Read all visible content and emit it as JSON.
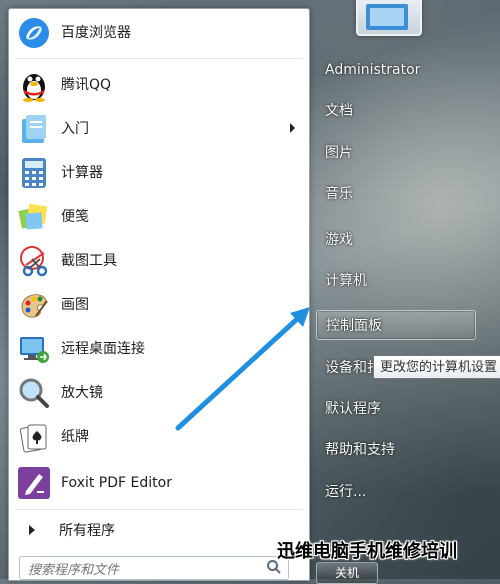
{
  "start_menu": {
    "programs": [
      {
        "label": "百度浏览器",
        "icon": "baidu-browser-icon"
      },
      {
        "label": "腾讯QQ",
        "icon": "qq-penguin-icon"
      },
      {
        "label": "入门",
        "icon": "getting-started-icon",
        "has_submenu": true
      },
      {
        "label": "计算器",
        "icon": "calculator-icon"
      },
      {
        "label": "便笺",
        "icon": "sticky-notes-icon"
      },
      {
        "label": "截图工具",
        "icon": "snipping-tool-icon"
      },
      {
        "label": "画图",
        "icon": "paint-palette-icon"
      },
      {
        "label": "远程桌面连接",
        "icon": "remote-desktop-icon"
      },
      {
        "label": "放大镜",
        "icon": "magnifier-icon"
      },
      {
        "label": "纸牌",
        "icon": "solitaire-cards-icon"
      },
      {
        "label": "Foxit PDF Editor",
        "icon": "foxit-pdf-icon"
      }
    ],
    "all_programs_label": "所有程序",
    "search_placeholder": "搜索程序和文件",
    "right_links": [
      {
        "label": "Administrator"
      },
      {
        "label": "文档"
      },
      {
        "label": "图片"
      },
      {
        "label": "音乐"
      },
      {
        "label": "游戏"
      },
      {
        "label": "计算机"
      },
      {
        "label": "控制面板",
        "highlighted": true
      },
      {
        "label": "设备和打"
      },
      {
        "label": "默认程序"
      },
      {
        "label": "帮助和支持"
      },
      {
        "label": "运行..."
      }
    ],
    "tooltip": "更改您的计算机设置",
    "shutdown_label": "关机"
  },
  "watermark": "迅维电脑手机维修培训",
  "colors": {
    "arrow": "#1f8fe0",
    "foxit": "#7b3f9e"
  }
}
